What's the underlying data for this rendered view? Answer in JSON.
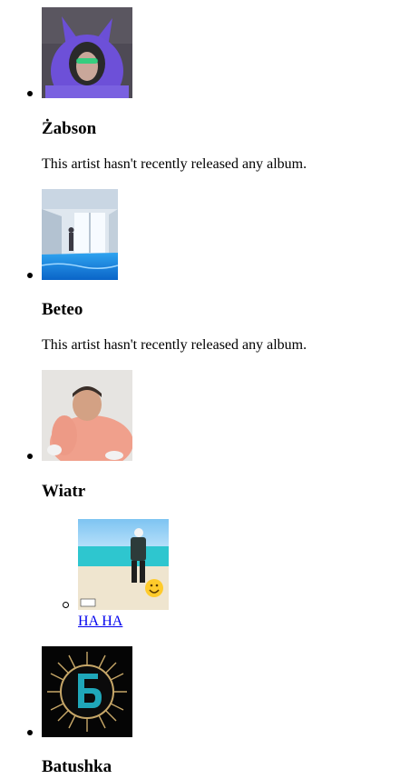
{
  "artists": [
    {
      "name": "Żabson",
      "image_alt": "Żabson artist photo",
      "empty_text": "This artist hasn't recently released any album."
    },
    {
      "name": "Beteo",
      "image_alt": "Beteo artist photo",
      "empty_text": "This artist hasn't recently released any album."
    },
    {
      "name": "Wiatr",
      "image_alt": "Wiatr artist photo",
      "albums": [
        {
          "title": "HA HA",
          "cover_alt": "HA HA album cover"
        }
      ]
    },
    {
      "name": "Batushka",
      "image_alt": "Batushka artist photo"
    }
  ]
}
